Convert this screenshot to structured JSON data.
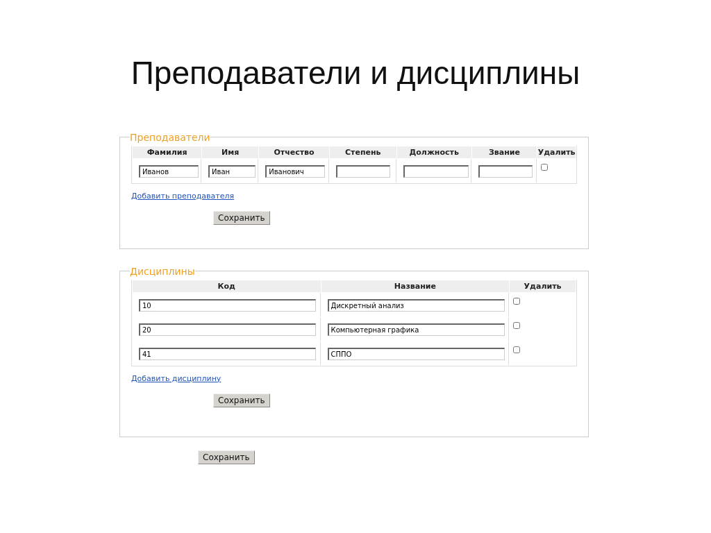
{
  "slide_title": "Преподаватели и дисциплины",
  "teachers": {
    "legend": "Преподаватели",
    "columns": [
      "Фамилия",
      "Имя",
      "Отчество",
      "Степень",
      "Должность",
      "Звание",
      "Удалить"
    ],
    "rows": [
      {
        "cells": [
          {
            "value": "Иванов"
          },
          {
            "value": "Иван"
          },
          {
            "value": "Иванович"
          },
          {},
          {},
          {}
        ],
        "delete_checked": false
      }
    ],
    "add_link": "Добавить преподавателя",
    "save_button": "Сохранить"
  },
  "disciplines": {
    "legend": "Дисциплины",
    "columns": [
      "Код",
      "Название",
      "Удалить"
    ],
    "rows": [
      {
        "cells": [
          {
            "value": "10"
          },
          {
            "value": "Дискретный анализ"
          }
        ],
        "delete_checked": false
      },
      {
        "cells": [
          {
            "value": "20"
          },
          {
            "value": "Компьютерная графика"
          }
        ],
        "delete_checked": false
      },
      {
        "cells": [
          {
            "value": "41"
          },
          {
            "value": "СППО"
          }
        ],
        "delete_checked": false
      }
    ],
    "add_link": "Добавить дисциплину",
    "save_button": "Сохранить"
  },
  "save_button": "Сохранить"
}
